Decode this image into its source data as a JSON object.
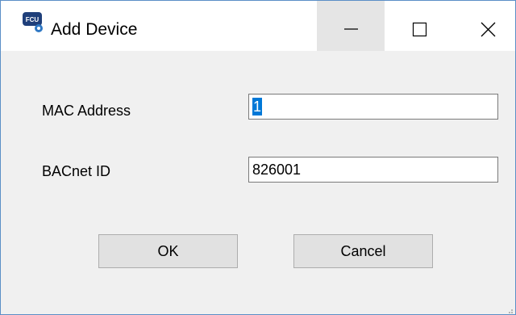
{
  "window": {
    "title": "Add Device",
    "app_icon": "fcu-device-icon",
    "app_icon_text": "FCU",
    "controls": {
      "minimize_icon": "minimize-icon",
      "maximize_icon": "maximize-icon",
      "close_icon": "close-icon"
    }
  },
  "form": {
    "mac_address": {
      "label": "MAC Address",
      "value": "1"
    },
    "bacnet_id": {
      "label": "BACnet ID",
      "value": "826001"
    }
  },
  "buttons": {
    "ok_label": "OK",
    "cancel_label": "Cancel"
  },
  "colors": {
    "accent": "#0078d7",
    "window_border": "#5b8fc7",
    "body_bg": "#f0f0f0",
    "titlebar_bg": "#ffffff",
    "button_bg": "#e1e1e1"
  }
}
